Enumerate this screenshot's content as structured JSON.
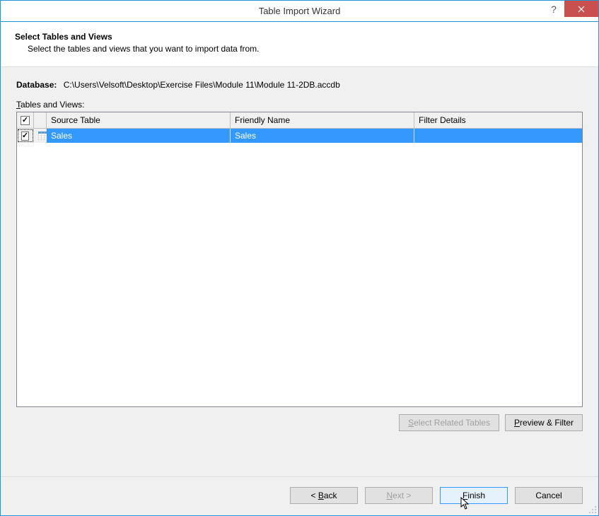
{
  "titlebar": {
    "title": "Table Import Wizard"
  },
  "header": {
    "title": "Select Tables and Views",
    "description": "Select the tables and views that you want to import data from."
  },
  "database": {
    "label": "Database:",
    "path": "C:\\Users\\Velsoft\\Desktop\\Exercise Files\\Module 11\\Module 11-2DB.accdb"
  },
  "tables_label_prefix": "T",
  "tables_label_rest": "ables and Views:",
  "grid": {
    "headers": {
      "source": "Source Table",
      "friendly": "Friendly Name",
      "filter": "Filter Details"
    },
    "rows": [
      {
        "checked": true,
        "source": "Sales",
        "friendly": "Sales",
        "filter": ""
      }
    ]
  },
  "buttons": {
    "select_related_prefix": "S",
    "select_related_rest": "elect Related Tables",
    "preview_prefix": "P",
    "preview_rest": "review & Filter",
    "back_prefix": "< ",
    "back_letter": "B",
    "back_rest": "ack",
    "next_letter": "N",
    "next_rest": "ext >",
    "finish_letter": "F",
    "finish_rest": "inish",
    "cancel": "Cancel"
  }
}
